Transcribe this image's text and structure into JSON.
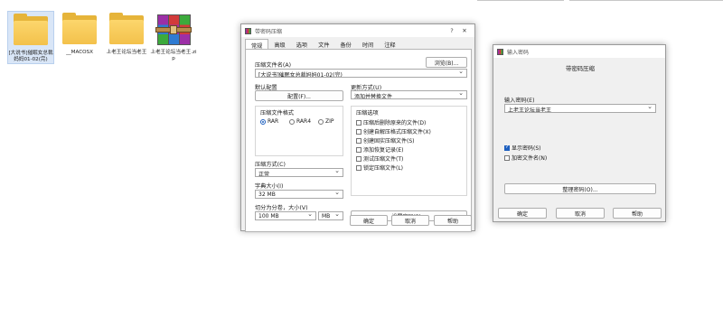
{
  "desktop": {
    "files": [
      {
        "name": "[大说书]催眠女总裁妈妈01-02(完)",
        "type": "folder"
      },
      {
        "name": "__MACOSX",
        "type": "folder"
      },
      {
        "name": "上老王论坛当老王",
        "type": "folder"
      },
      {
        "name": "上老王论坛当老王.zip",
        "type": "archive"
      }
    ]
  },
  "compress_dialog": {
    "title": "带密码压缩",
    "help_glyph": "?",
    "close_glyph": "✕",
    "tabs": [
      "常规",
      "高级",
      "选项",
      "文件",
      "备份",
      "时间",
      "注释"
    ],
    "archive_name_label": "压缩文件名(A)",
    "browse_button": "浏览(B)...",
    "archive_name_value": "[大说书]催眠女总裁妈妈01-02(完)",
    "default_profile_label": "默认配置",
    "profile_button": "配置(F)...",
    "update_mode_label": "更新方式(U)",
    "update_mode_value": "添加并替换文件",
    "format_label": "压缩文件格式",
    "formats": [
      "RAR",
      "RAR4",
      "ZIP"
    ],
    "options_label": "压缩选项",
    "options": [
      "压缩后删除原来的文件(D)",
      "创建自解压格式压缩文件(X)",
      "创建固实压缩文件(S)",
      "添加恢复记录(E)",
      "测试压缩文件(T)",
      "锁定压缩文件(L)"
    ],
    "method_label": "压缩方式(C)",
    "method_value": "正常",
    "dict_label": "字典大小(I)",
    "dict_value": "32 MB",
    "split_label": "切分为分卷，大小(V)",
    "split_value": "100 MB",
    "split_unit": "MB",
    "set_password_button": "设置密码(P)...",
    "ok_button": "确定",
    "cancel_button": "取消",
    "help_button": "帮助"
  },
  "password_dialog": {
    "title": "输入密码",
    "heading": "带密码压缩",
    "password_label": "输入密码(E)",
    "password_value": "上老王论坛当老王",
    "show_password_label": "显示密码(S)",
    "encrypt_names_label": "加密文件名(N)",
    "organize_button": "整理密码(O)...",
    "ok_button": "确定",
    "cancel_button": "取消",
    "help_button": "帮助"
  }
}
